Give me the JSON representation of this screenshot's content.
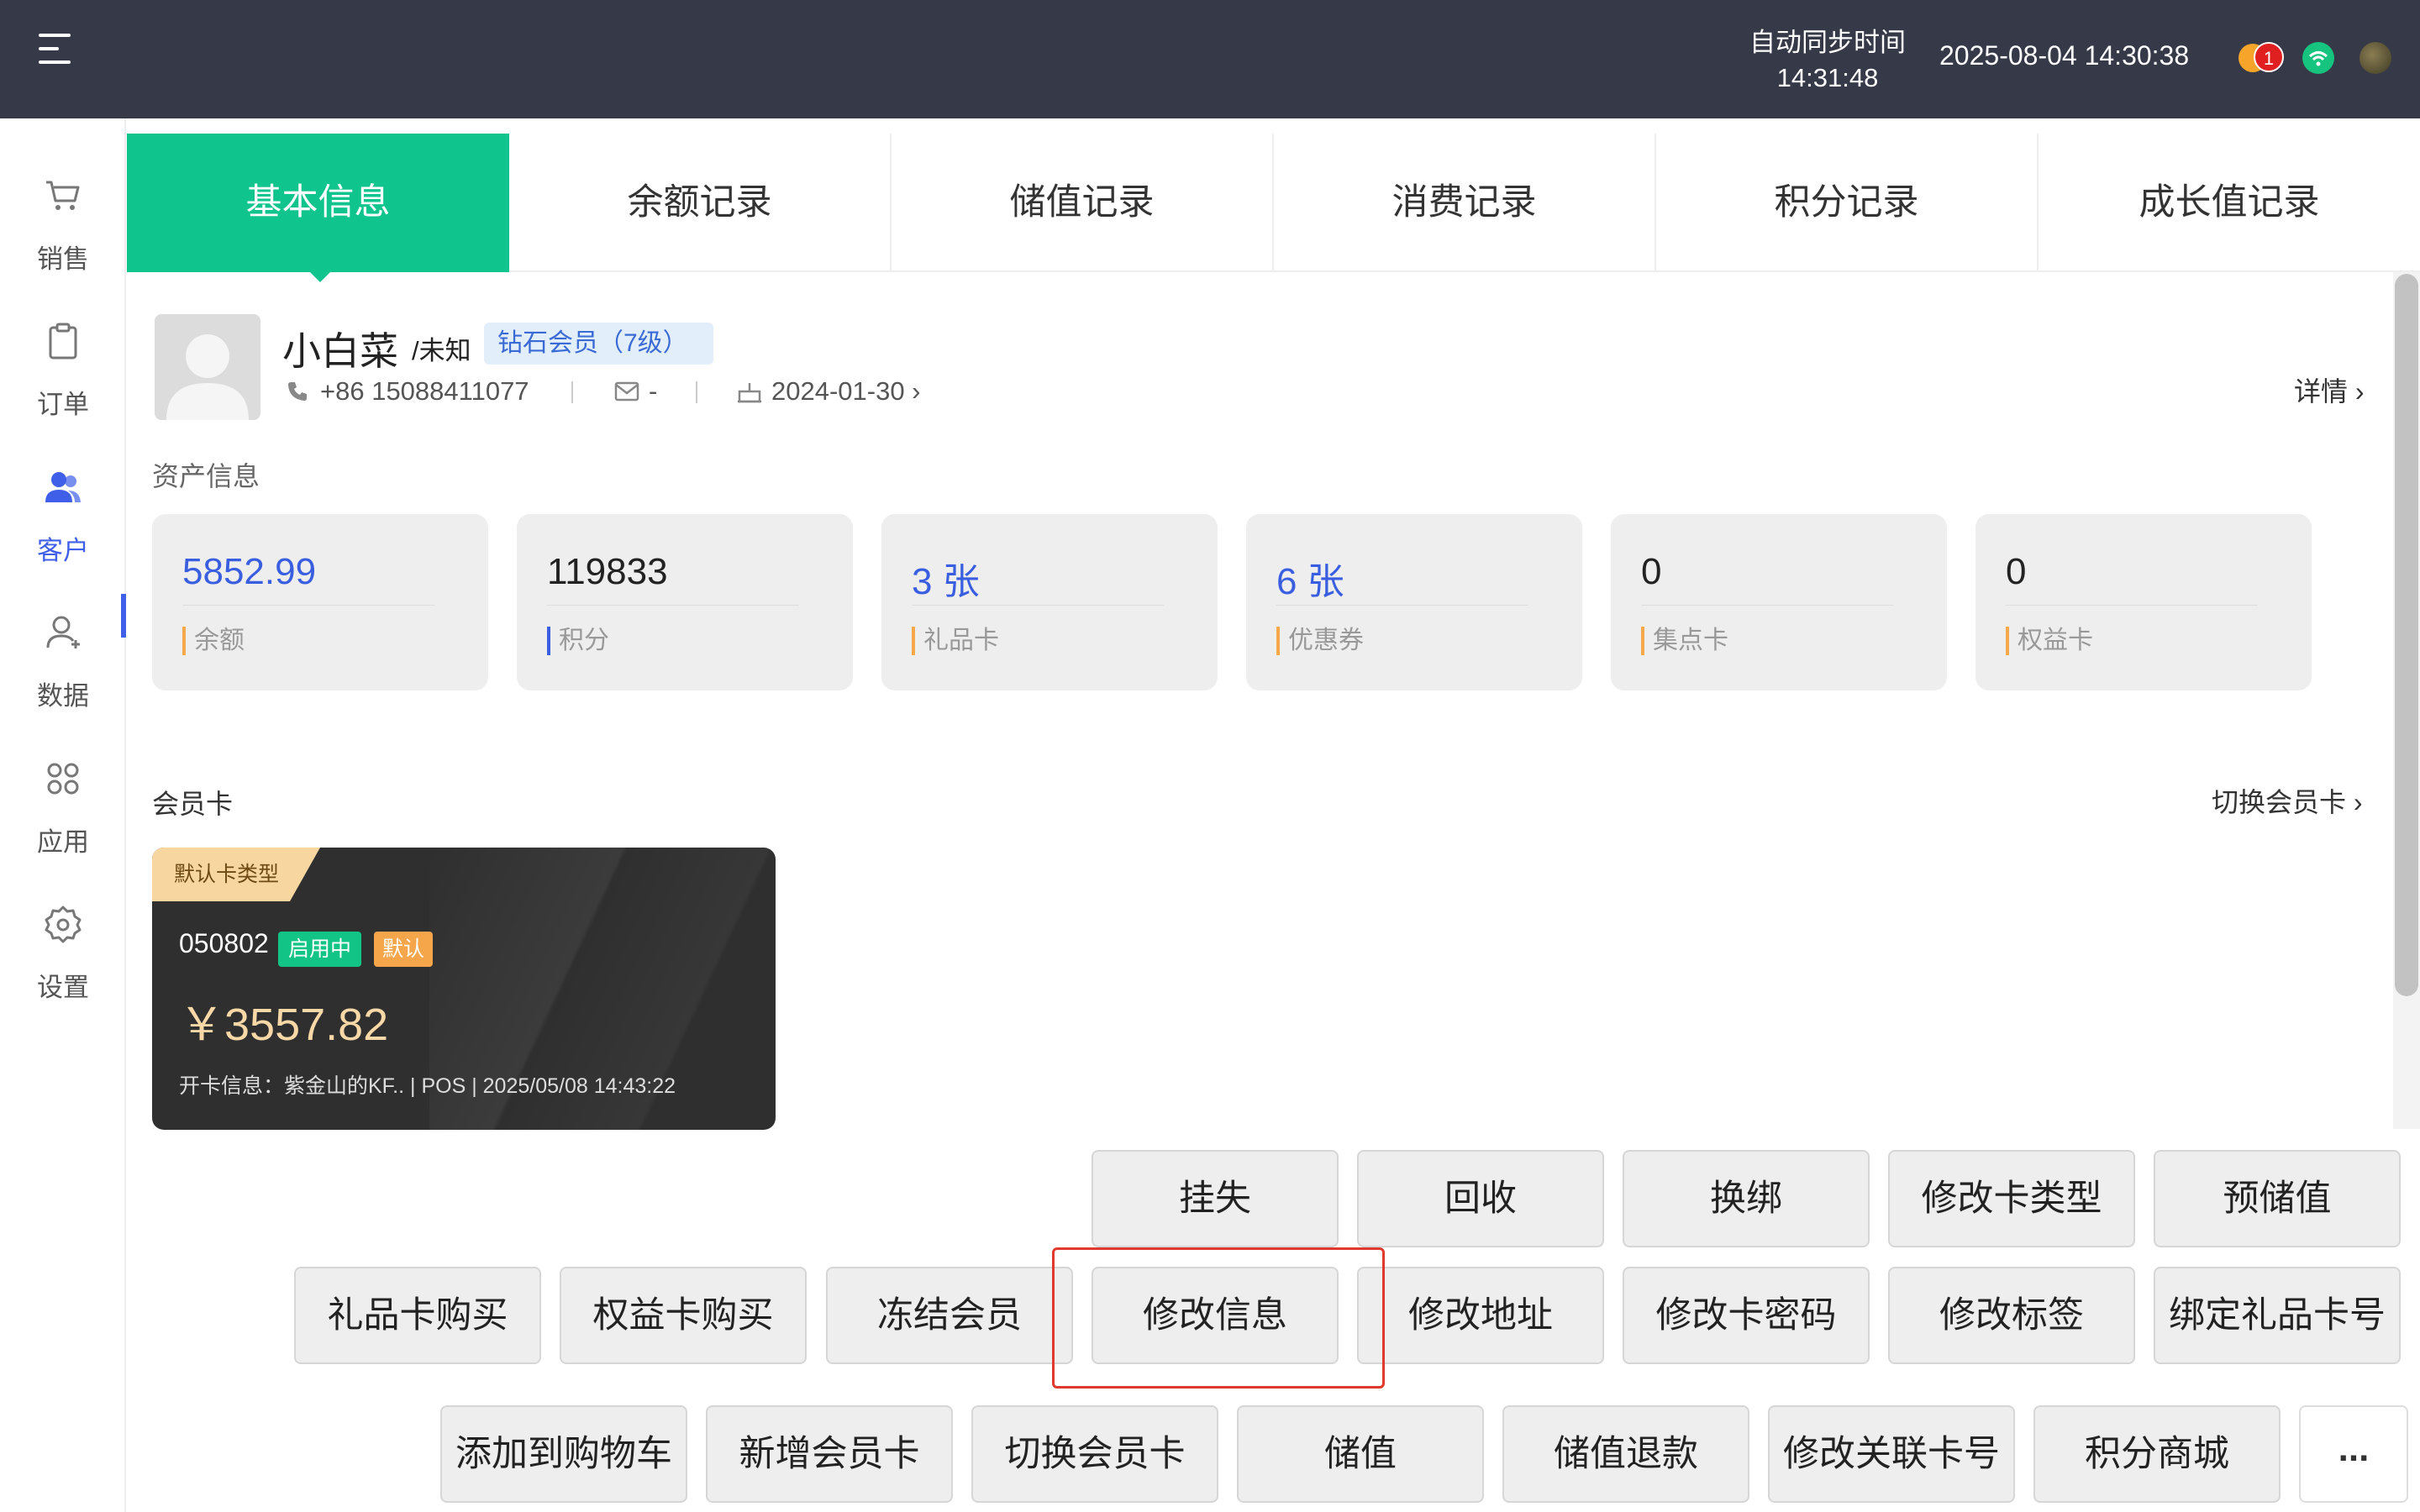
{
  "topbar": {
    "sync_label": "自动同步时间",
    "sync_time": "14:31:48",
    "datetime": "2025-08-04 14:30:38",
    "notification_count": "1"
  },
  "sidebar": {
    "items": [
      {
        "label": "销售",
        "icon": "cart-icon"
      },
      {
        "label": "订单",
        "icon": "clipboard-icon"
      },
      {
        "label": "客户",
        "icon": "users-icon"
      },
      {
        "label": "数据",
        "icon": "user-icon"
      },
      {
        "label": "应用",
        "icon": "apps-icon"
      },
      {
        "label": "设置",
        "icon": "gear-icon"
      }
    ],
    "active": "客户"
  },
  "tabs": [
    "基本信息",
    "余额记录",
    "储值记录",
    "消费记录",
    "积分记录",
    "成长值记录"
  ],
  "profile": {
    "name": "小白菜",
    "gender": "/未知",
    "level": "钻石会员（7级）",
    "phone": "+86 15088411077",
    "email": "-",
    "birthday": "2024-01-30 ›",
    "detail_link": "详情 ›"
  },
  "assets": {
    "title": "资产信息",
    "cards": [
      {
        "value": "5852.99",
        "label": "余额"
      },
      {
        "value": "119833",
        "label": "积分"
      },
      {
        "value": "3 张",
        "label": "礼品卡"
      },
      {
        "value": "6 张",
        "label": "优惠券"
      },
      {
        "value": "0",
        "label": "集点卡"
      },
      {
        "value": "0",
        "label": "权益卡"
      }
    ]
  },
  "member_card": {
    "section_title": "会员卡",
    "switch_label": "切换会员卡 ›",
    "type": "默认卡类型",
    "number": "050802",
    "status": "启用中",
    "default_tag": "默认",
    "balance": "￥3557.82",
    "info": "开卡信息：紫金山的KF.. | POS | 2025/05/08 14:43:22"
  },
  "actions": {
    "row1": [
      "挂失",
      "回收",
      "换绑",
      "修改卡类型",
      "预储值"
    ],
    "row2": [
      "礼品卡购买",
      "权益卡购买",
      "冻结会员",
      "修改信息",
      "修改地址",
      "修改卡密码",
      "修改标签",
      "绑定礼品卡号"
    ],
    "row3": [
      "添加到购物车",
      "新增会员卡",
      "切换会员卡",
      "储值",
      "储值退款",
      "修改关联卡号",
      "积分商城"
    ],
    "more": "..."
  },
  "colors": {
    "topbar": "#363947",
    "accent_green": "#0fc48d",
    "accent_blue": "#3f5fe8",
    "highlight_red": "#e03a2f"
  }
}
